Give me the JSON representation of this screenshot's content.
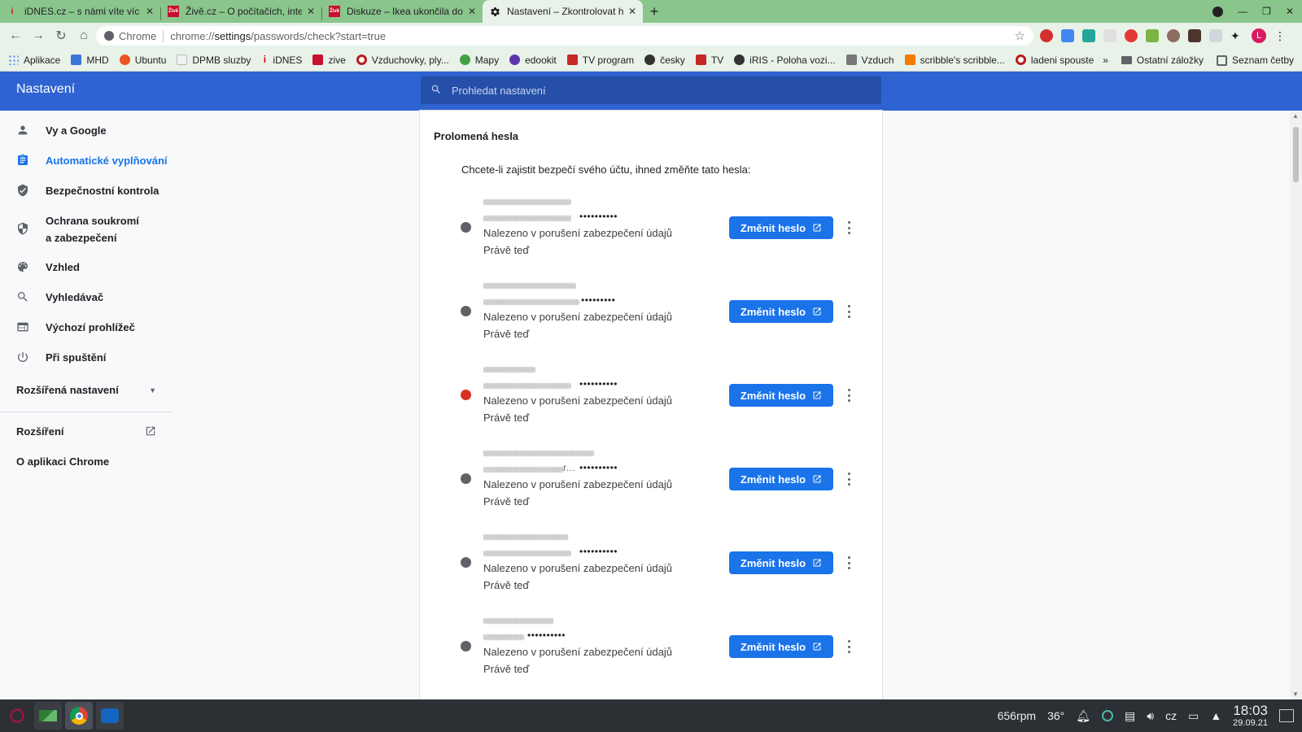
{
  "browser": {
    "tabs": [
      {
        "title": "iDNES.cz – s námi víte víc",
        "icon": "idnes-icon",
        "color": "#d80000",
        "active": false
      },
      {
        "title": "Živě.cz – O počítačích, interne",
        "icon": "zive-icon",
        "color": "#c8102e",
        "active": false
      },
      {
        "title": "Diskuze – Ikea ukončila dobu",
        "icon": "zive-icon",
        "color": "#c8102e",
        "active": false
      },
      {
        "title": "Nastavení – Zkontrolovat hes",
        "icon": "gear-icon",
        "color": "#5f6368",
        "active": true
      }
    ],
    "new_tab": "+",
    "omnibox": {
      "site": "Chrome",
      "url_prefix": "chrome://",
      "url_bold": "settings",
      "url_rest": "/passwords/check?start=true"
    },
    "profile_initial": "L",
    "accent_color": "#8ac58c"
  },
  "bookmarks": {
    "items": [
      {
        "label": "Aplikace",
        "color": "#4285f4"
      },
      {
        "label": "MHD",
        "color": "#3a76d8"
      },
      {
        "label": "Ubuntu",
        "color": "#e95420"
      },
      {
        "label": "DPMB sluzby",
        "color": "#bbbbbb"
      },
      {
        "label": "iDNES",
        "color": "#d80000"
      },
      {
        "label": "zive",
        "color": "#c8102e"
      },
      {
        "label": "Vzduchovky, ply...",
        "color": "#b71c1c"
      },
      {
        "label": "Mapy",
        "color": "#43a047"
      },
      {
        "label": "edookit",
        "color": "#5e35b1"
      },
      {
        "label": "TV program",
        "color": "#c62828"
      },
      {
        "label": "česky",
        "color": "#333333"
      },
      {
        "label": "TV",
        "color": "#c62828"
      },
      {
        "label": "iRIS - Poloha vozi...",
        "color": "#333333"
      },
      {
        "label": "Vzduch",
        "color": "#777777"
      },
      {
        "label": "scribble's scribble...",
        "color": "#f57c00"
      },
      {
        "label": "ladeni spouste",
        "color": "#b71c1c"
      }
    ],
    "overflow": "»",
    "other_label": "Ostatní záložky",
    "reading_list_label": "Seznam četby"
  },
  "settings": {
    "header_title": "Nastavení",
    "search_placeholder": "Prohledat nastavení",
    "header_color": "#2f63d1",
    "sidebar": {
      "items": [
        {
          "label": "Vy a Google",
          "icon": "person-icon",
          "active": false
        },
        {
          "label": "Automatické vyplňování",
          "icon": "clipboard-icon",
          "active": true
        },
        {
          "label": "Bezpečnostní kontrola",
          "icon": "shield-check-icon",
          "active": false
        },
        {
          "label": "Ochrana soukromí\na zabezpečení",
          "label_1": "Ochrana soukromí",
          "label_2": "a zabezpečení",
          "icon": "shield-icon",
          "active": false
        },
        {
          "label": "Vzhled",
          "icon": "palette-icon",
          "active": false
        },
        {
          "label": "Vyhledávač",
          "icon": "search-icon",
          "active": false
        },
        {
          "label": "Výchozí prohlížeč",
          "icon": "browser-icon",
          "active": false
        },
        {
          "label": "Při spuštění",
          "icon": "power-icon",
          "active": false
        }
      ],
      "advanced_label": "Rozšířená nastavení",
      "extensions_label": "Rozšíření",
      "about_label": "O aplikaci Chrome"
    },
    "main": {
      "section_title": "Prolomená hesla",
      "intro": "Chcete-li zajistit bezpečí svého účtu, ihned změňte tato hesla:",
      "change_button_label": "Změnit heslo",
      "entries": [
        {
          "icon": "globe-icon",
          "password_mask": "••••••••••",
          "status": "Nalezeno v porušení zabezpečení údajů",
          "time": "Právě teď"
        },
        {
          "icon": "globe-icon",
          "password_mask": "•••••••••",
          "status": "Nalezeno v porušení zabezpečení údajů",
          "time": "Právě teď"
        },
        {
          "icon": "gmail-icon",
          "password_mask": "••••••••••",
          "status": "Nalezeno v porušení zabezpečení údajů",
          "time": "Právě teď"
        },
        {
          "icon": "globe-icon",
          "password_mask": "••••••••••",
          "status": "Nalezeno v porušení zabezpečení údajů",
          "time": "Právě teď",
          "masked_suffix": "r..."
        },
        {
          "icon": "globe-icon",
          "password_mask": "••••••••••",
          "status": "Nalezeno v porušení zabezpečení údajů",
          "time": "Právě teď"
        },
        {
          "icon": "globe-icon",
          "password_mask": "••••••••••",
          "status": "Nalezeno v porušení zabezpečení údajů",
          "time": "Právě teď"
        }
      ]
    }
  },
  "taskbar": {
    "rpm": "656rpm",
    "temp": "36°",
    "lang": "cz",
    "time": "18:03",
    "date": "29.09.21"
  }
}
